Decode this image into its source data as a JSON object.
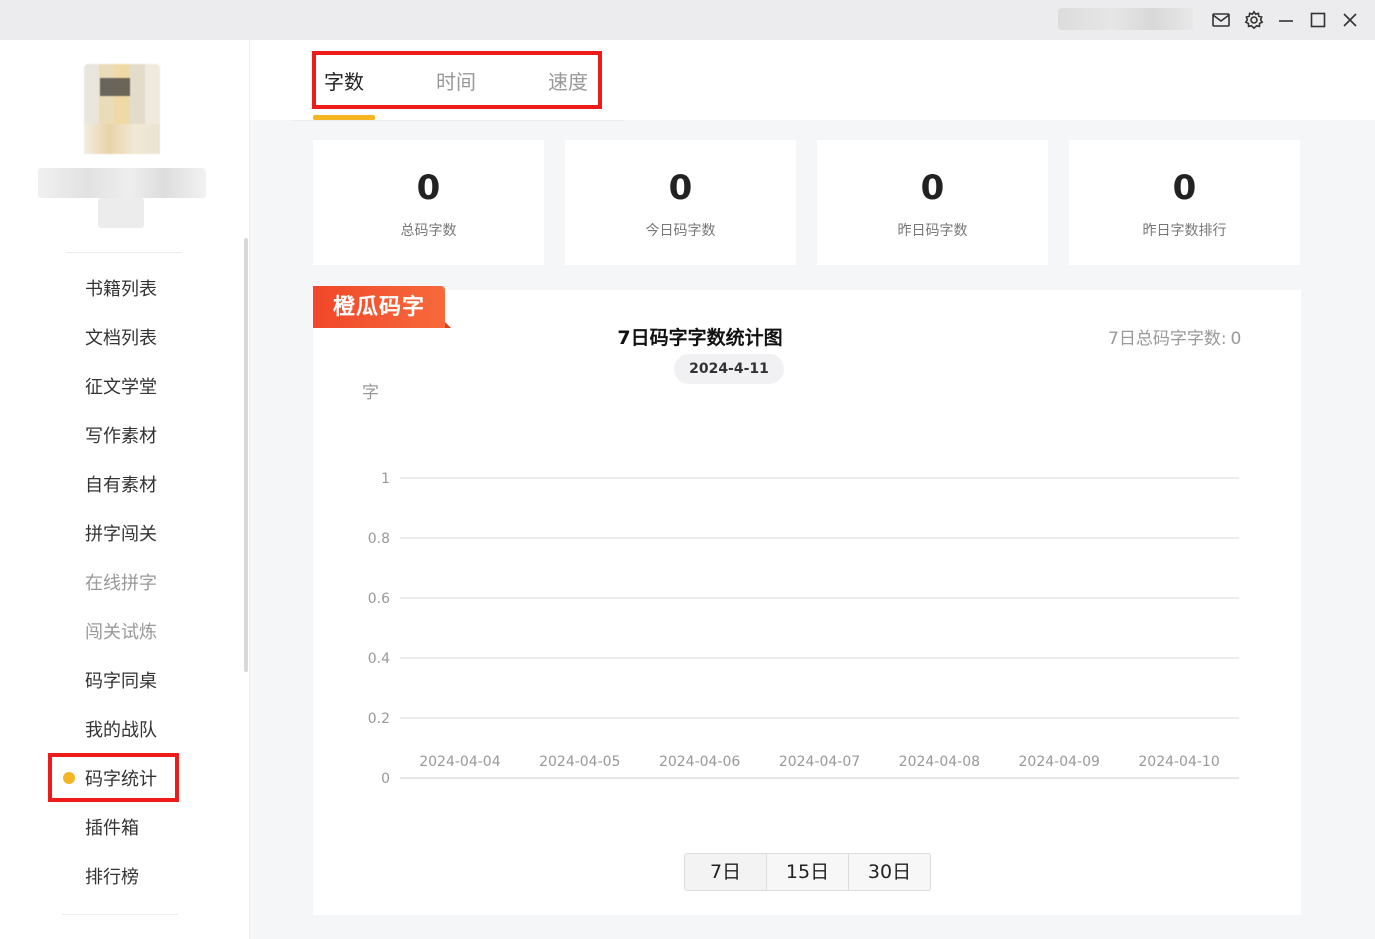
{
  "titlebar": {
    "icons": [
      "mail-icon",
      "gear-icon",
      "minimize-icon",
      "maximize-icon",
      "close-icon"
    ]
  },
  "sidebar": {
    "items": [
      {
        "label": "书籍列表",
        "muted": false
      },
      {
        "label": "文档列表",
        "muted": false
      },
      {
        "label": "征文学堂",
        "muted": false
      },
      {
        "label": "写作素材",
        "muted": false
      },
      {
        "label": "自有素材",
        "muted": false
      },
      {
        "label": "拼字闯关",
        "muted": false
      },
      {
        "label": "在线拼字",
        "muted": true
      },
      {
        "label": "闯关试炼",
        "muted": true
      },
      {
        "label": "码字同桌",
        "muted": false
      },
      {
        "label": "我的战队",
        "muted": false
      },
      {
        "label": "码字统计",
        "muted": false,
        "active": true
      },
      {
        "label": "插件箱",
        "muted": false
      },
      {
        "label": "排行榜",
        "muted": false
      }
    ]
  },
  "tabs": [
    {
      "label": "字数",
      "active": true
    },
    {
      "label": "时间",
      "active": false
    },
    {
      "label": "速度",
      "active": false
    }
  ],
  "stats": [
    {
      "value": "0",
      "label": "总码字数"
    },
    {
      "value": "0",
      "label": "今日码字数"
    },
    {
      "value": "0",
      "label": "昨日码字数"
    },
    {
      "value": "0",
      "label": "昨日字数排行"
    }
  ],
  "panel": {
    "brand": "橙瓜码字",
    "date": "2024-4-11",
    "total_label": "7日总码字字数:",
    "total_value": "0"
  },
  "ranges": [
    {
      "label": "7日",
      "active": true
    },
    {
      "label": "15日",
      "active": false
    },
    {
      "label": "30日",
      "active": false
    }
  ],
  "colors": {
    "accent": "#f5b523",
    "brand": "#f0472a",
    "highlight_box": "#ee1b1b"
  },
  "chart_data": {
    "type": "line",
    "title": "7日码字字数统计图",
    "ylabel": "字",
    "xlabel": "",
    "categories": [
      "2024-04-04",
      "2024-04-05",
      "2024-04-06",
      "2024-04-07",
      "2024-04-08",
      "2024-04-09",
      "2024-04-10"
    ],
    "series": [
      {
        "values": [
          0,
          0,
          0,
          0,
          0,
          0,
          0
        ]
      }
    ],
    "yticks": [
      "0",
      "0.2",
      "0.4",
      "0.6",
      "0.8",
      "1"
    ],
    "ylim": [
      0,
      1
    ],
    "grid": true
  }
}
